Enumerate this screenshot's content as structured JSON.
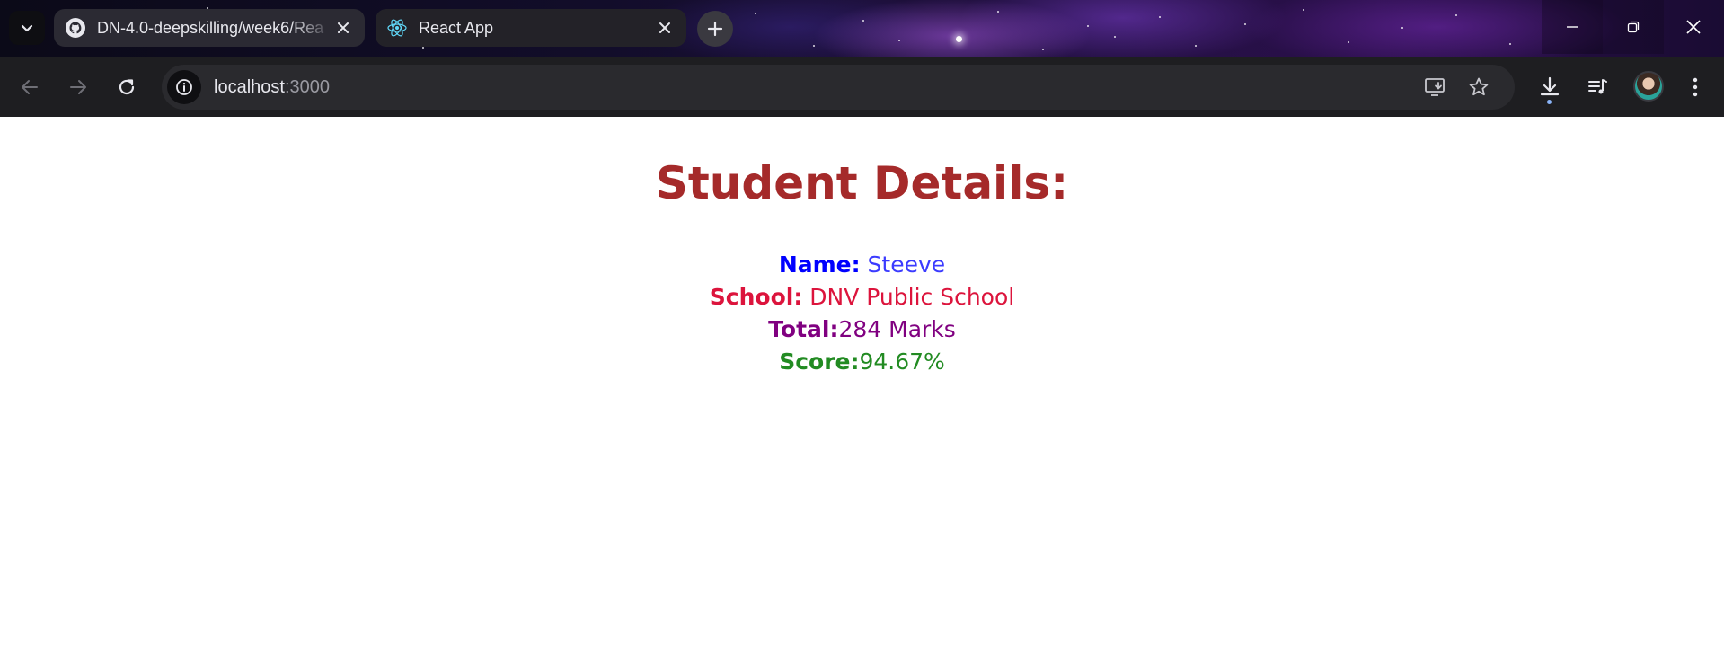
{
  "browser": {
    "tabs": [
      {
        "title": "DN-4.0-deepskilling/week6/Rea",
        "icon": "github-icon"
      },
      {
        "title": "React App",
        "icon": "react-icon"
      }
    ],
    "address": {
      "host": "localhost",
      "port": ":3000"
    }
  },
  "page": {
    "title": "Student Details:",
    "fields": {
      "name": {
        "label": "Name:",
        "value": " Steeve"
      },
      "school": {
        "label": "School:",
        "value": " DNV Public School"
      },
      "total": {
        "label": "Total:",
        "value": "284 Marks"
      },
      "score": {
        "label": "Score:",
        "value": "94.67%"
      }
    }
  },
  "colors": {
    "title": "#a52a2a",
    "name": "#0000ff",
    "school": "#dc143c",
    "total": "#800080",
    "score": "#228b22"
  }
}
